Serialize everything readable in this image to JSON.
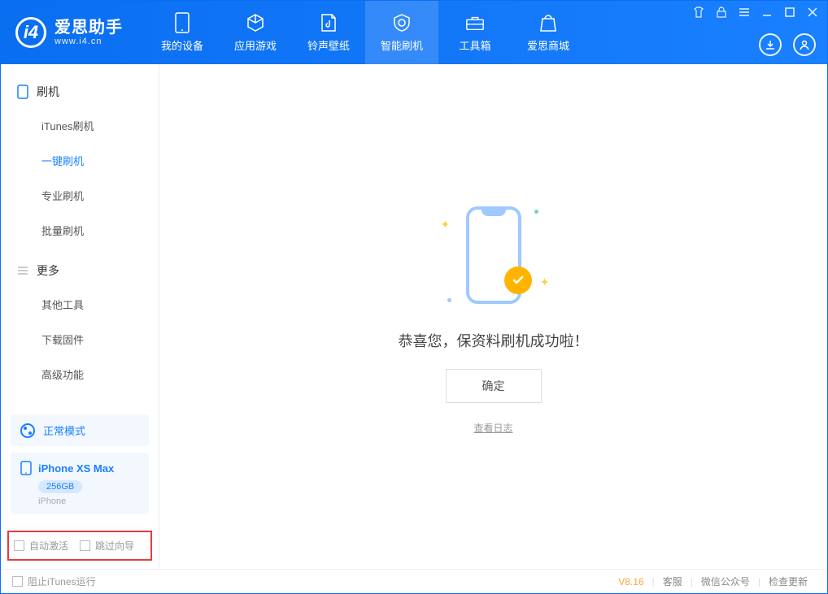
{
  "app": {
    "title": "爱思助手",
    "subtitle": "www.i4.cn"
  },
  "nav": {
    "items": [
      {
        "label": "我的设备"
      },
      {
        "label": "应用游戏"
      },
      {
        "label": "铃声壁纸"
      },
      {
        "label": "智能刷机"
      },
      {
        "label": "工具箱"
      },
      {
        "label": "爱思商城"
      }
    ]
  },
  "sidebar": {
    "groups": [
      {
        "title": "刷机",
        "items": [
          "iTunes刷机",
          "一键刷机",
          "专业刷机",
          "批量刷机"
        ]
      },
      {
        "title": "更多",
        "items": [
          "其他工具",
          "下载固件",
          "高级功能"
        ]
      }
    ],
    "mode": "正常模式",
    "device": {
      "name": "iPhone XS Max",
      "storage": "256GB",
      "type": "iPhone"
    },
    "options": {
      "auto_activate": "自动激活",
      "skip_guide": "跳过向导"
    }
  },
  "main": {
    "message": "恭喜您，保资料刷机成功啦！",
    "ok": "确定",
    "view_log": "查看日志"
  },
  "footer": {
    "block_itunes": "阻止iTunes运行",
    "version": "V8.16",
    "links": [
      "客服",
      "微信公众号",
      "检查更新"
    ]
  }
}
